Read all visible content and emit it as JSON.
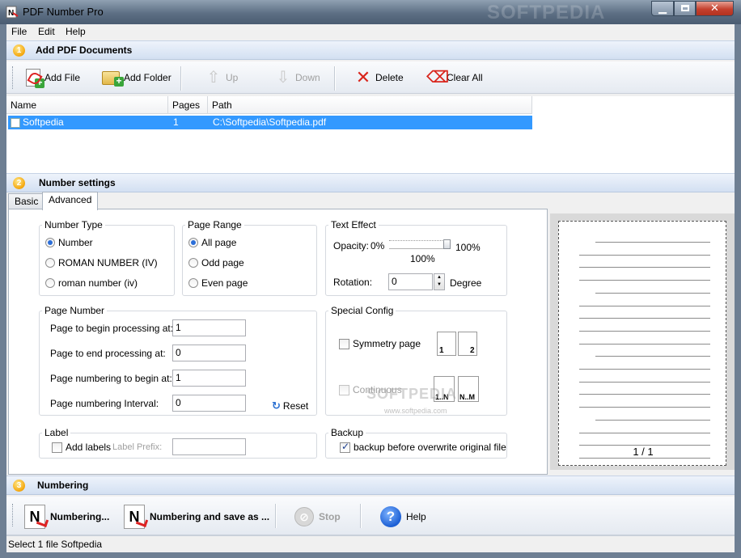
{
  "window": {
    "title": "PDF Number Pro",
    "watermark": "SOFTPEDIA"
  },
  "menu": [
    "File",
    "Edit",
    "Help"
  ],
  "section1": {
    "num": "1",
    "title": "Add PDF Documents"
  },
  "toolbar": {
    "add_file": "Add File",
    "add_folder": "Add Folder",
    "up": "Up",
    "down": "Down",
    "delete": "Delete",
    "clear_all": "Clear All"
  },
  "filelist": {
    "columns": [
      "Name",
      "Pages",
      "Path"
    ],
    "rows": [
      {
        "name": "Softpedia",
        "pages": "1",
        "path": "C:\\Softpedia\\Softpedia.pdf"
      }
    ]
  },
  "section2": {
    "num": "2",
    "title": "Number settings"
  },
  "tabs": [
    "Basic",
    "Advanced"
  ],
  "number_type": {
    "label": "Number Type",
    "options": [
      "Number",
      "ROMAN NUMBER (IV)",
      "roman number (iv)"
    ]
  },
  "page_range": {
    "label": "Page Range",
    "options": [
      "All page",
      "Odd page",
      "Even page"
    ]
  },
  "text_effect": {
    "label": "Text Effect",
    "opacity_label": "Opacity:",
    "opacity_min": "0%",
    "opacity_max": "100%",
    "opacity_value": "100%",
    "rotation_label": "Rotation:",
    "rotation_value": "0",
    "rotation_unit": "Degree"
  },
  "page_number": {
    "label": "Page Number",
    "begin_processing_label": "Page to begin processing at:",
    "begin_processing_value": "1",
    "end_processing_label": "Page to end processing at:",
    "end_processing_value": "0",
    "numbering_begin_label": "Page numbering to begin at:",
    "numbering_begin_value": "1",
    "interval_label": "Page numbering Interval:",
    "interval_value": "0",
    "reset": "Reset"
  },
  "special_config": {
    "label": "Special Config",
    "symmetry": "Symmetry page",
    "continuous": "Continuous",
    "sym_left": "1",
    "sym_right": "2",
    "cont_left": "1..N",
    "cont_right": "N..M",
    "watermark": "SOFTPEDIA",
    "watermark_url": "www.softpedia.com"
  },
  "label_group": {
    "label": "Label",
    "add_labels": "Add labels",
    "prefix_label": "Label Prefix:"
  },
  "backup": {
    "label": "Backup",
    "option": "backup before overwrite original file"
  },
  "preview": {
    "page_counter": "1 / 1"
  },
  "section3": {
    "num": "3",
    "title": "Numbering"
  },
  "bottom_toolbar": {
    "numbering": "Numbering...",
    "numbering_save": "Numbering and save as ...",
    "stop": "Stop",
    "help": "Help"
  },
  "status": "Select 1 file Softpedia"
}
